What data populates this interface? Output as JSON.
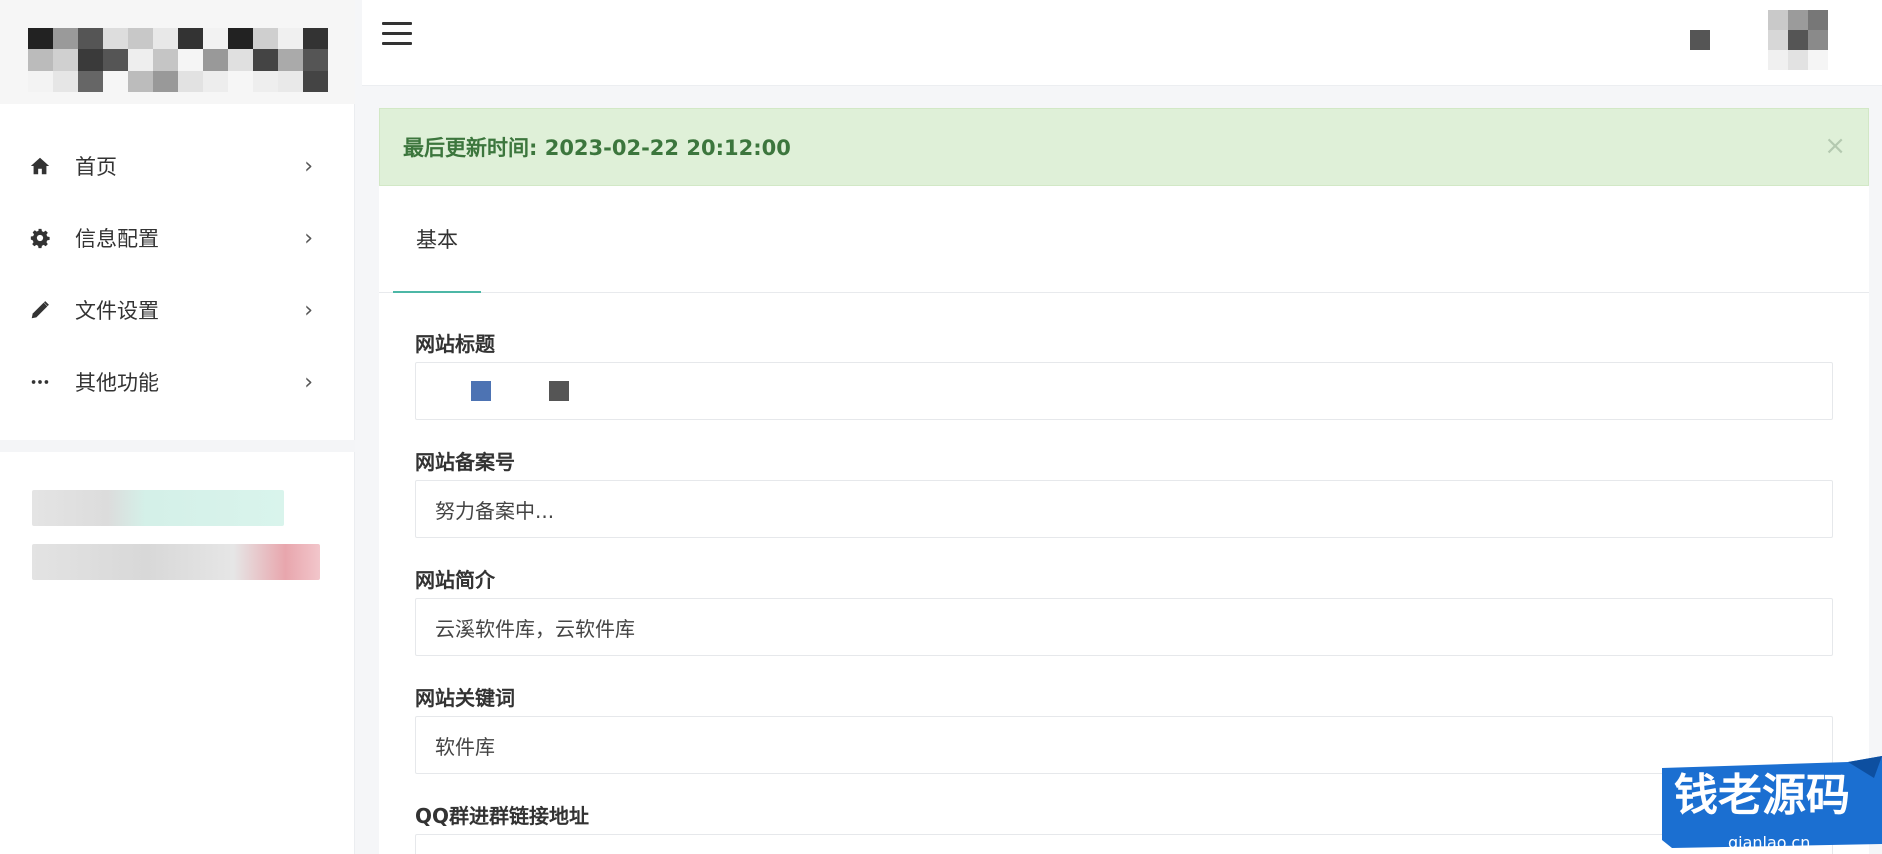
{
  "sidebar": {
    "items": [
      {
        "label": "首页",
        "icon": "home-icon"
      },
      {
        "label": "信息配置",
        "icon": "gear-icon"
      },
      {
        "label": "文件设置",
        "icon": "pencil-icon"
      },
      {
        "label": "其他功能",
        "icon": "more-icon"
      }
    ],
    "chevron": "›"
  },
  "alert": {
    "text": "最后更新时间: 2023-02-22 20:12:00",
    "close": "×",
    "bg_color": "#dff0d8",
    "text_color": "#3c763d"
  },
  "tabs": [
    {
      "label": "基本",
      "active": true
    }
  ],
  "form": {
    "fields": [
      {
        "label": "网站标题",
        "value": ""
      },
      {
        "label": "网站备案号",
        "value": "努力备案中..."
      },
      {
        "label": "网站简介",
        "value": "云溪软件库，云软件库"
      },
      {
        "label": "网站关键词",
        "value": "软件库"
      },
      {
        "label": "QQ群进群链接地址",
        "value": ""
      }
    ]
  },
  "watermark": {
    "title": "钱老源码",
    "url": "qianlao.cn"
  },
  "colors": {
    "accent": "#4cb7a6",
    "badge_blue": "#1b6fd1"
  }
}
